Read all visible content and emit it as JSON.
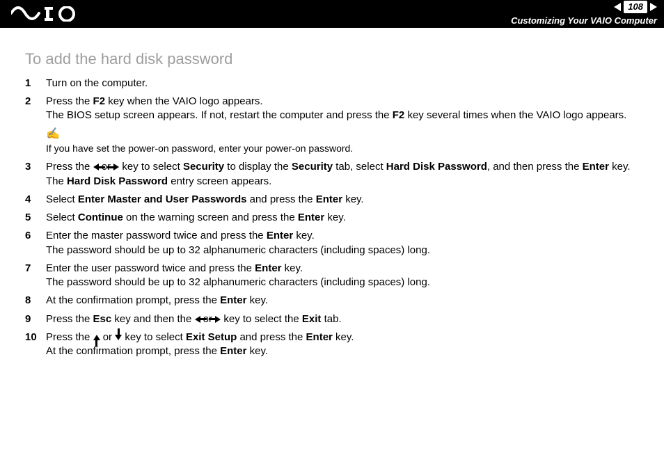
{
  "header": {
    "page_number": "108",
    "section": "Customizing Your VAIO Computer"
  },
  "heading": "To add the hard disk password",
  "steps": [
    {
      "n": "1",
      "html": "Turn on the computer."
    },
    {
      "n": "2",
      "html": "Press the <b>F2</b> key when the VAIO logo appears.<br>The BIOS setup screen appears. If not, restart the computer and press the <b>F2</b> key several times when the VAIO logo appears."
    },
    {
      "note": true,
      "text": "If you have set the power-on password, enter your power-on password."
    },
    {
      "n": "3",
      "html": "Press the <span class='arr-left' data-name='arrow-left-icon' data-interactable='false'></span> or <span class='arr-right' data-name='arrow-right-icon' data-interactable='false'></span> key to select <b>Security</b> to display the <b>Security</b> tab, select <b>Hard Disk Password</b>, and then press the <b>Enter</b> key.<br>The <b>Hard Disk Password</b> entry screen appears."
    },
    {
      "n": "4",
      "html": "Select <b>Enter Master and User Passwords</b> and press the <b>Enter</b> key."
    },
    {
      "n": "5",
      "html": "Select <b>Continue</b> on the warning screen and press the <b>Enter</b> key."
    },
    {
      "n": "6",
      "html": "Enter the master password twice and press the <b>Enter</b> key.<br>The password should be up to 32 alphanumeric characters (including spaces) long."
    },
    {
      "n": "7",
      "html": "Enter the user password twice and press the <b>Enter</b> key.<br>The password should be up to 32 alphanumeric characters (including spaces) long."
    },
    {
      "n": "8",
      "html": "At the confirmation prompt, press the <b>Enter</b> key."
    },
    {
      "n": "9",
      "html": "Press the <b>Esc</b> key and then the <span class='arr-left' data-name='arrow-left-icon' data-interactable='false'></span> or <span class='arr-right' data-name='arrow-right-icon' data-interactable='false'></span> key to select the <b>Exit</b> tab."
    },
    {
      "n": "10",
      "html": "Press the <span class='arr-up' data-name='arrow-up-icon' data-interactable='false'></span> or <span class='arr-down' data-name='arrow-down-icon' data-interactable='false'></span> key to select <b>Exit Setup</b> and press the <b>Enter</b> key.<br>At the confirmation prompt, press the <b>Enter</b> key."
    }
  ]
}
